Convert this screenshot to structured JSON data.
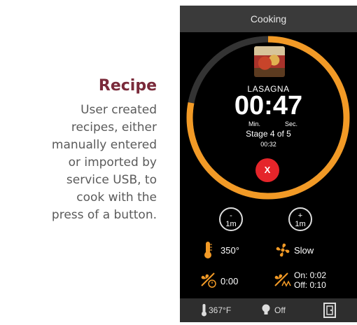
{
  "description": {
    "title": "Recipe",
    "lines": [
      "User created",
      "recipes, either",
      "manually entered",
      "or imported by",
      "service USB, to",
      "cook with the",
      "press of a button."
    ]
  },
  "screen": {
    "header_title": "Cooking",
    "recipe_name": "LASAGNA",
    "timer": "00:47",
    "timer_min_label": "Min.",
    "timer_sec_label": "Sec.",
    "stage": "Stage 4 of 5",
    "stage_time": "00:32",
    "cancel_label": "X",
    "progress_fraction": 0.78,
    "minus_symbol": "-",
    "minus_label": "1m",
    "plus_symbol": "+",
    "plus_label": "1m",
    "temperature": "350°",
    "fan": "Slow",
    "delay": "0:00",
    "cycle_on": "On: 0:02",
    "cycle_off": "Off: 0:10",
    "footer_temp": "367°F",
    "footer_light": "Off"
  },
  "colors": {
    "accent": "#f29a26",
    "cancel": "#e5252a",
    "title": "#7a2a3a"
  },
  "icons": {
    "temperature": "thermometer-icon",
    "fan": "fan-icon",
    "delay": "fan-timer-icon",
    "cycle": "fan-cycle-icon",
    "light": "lightbulb-icon",
    "door": "door-icon"
  }
}
